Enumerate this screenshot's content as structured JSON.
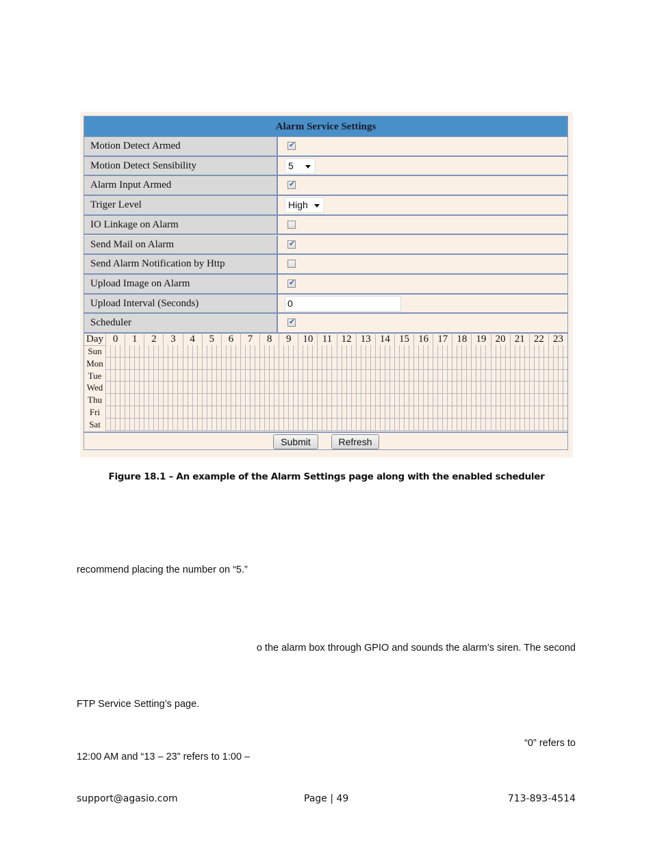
{
  "panel": {
    "title": "Alarm Service Settings",
    "rows": [
      {
        "label": "Motion Detect Armed",
        "type": "checkbox",
        "checked": true
      },
      {
        "label": "Motion Detect Sensibility",
        "type": "select",
        "value": "5"
      },
      {
        "label": "Alarm Input Armed",
        "type": "checkbox",
        "checked": true
      },
      {
        "label": "Triger Level",
        "type": "select",
        "value": "High"
      },
      {
        "label": "IO Linkage on Alarm",
        "type": "checkbox",
        "checked": false
      },
      {
        "label": "Send Mail on Alarm",
        "type": "checkbox",
        "checked": true
      },
      {
        "label": "Send Alarm Notification by Http",
        "type": "checkbox",
        "checked": false
      },
      {
        "label": "Upload Image on Alarm",
        "type": "checkbox",
        "checked": true
      },
      {
        "label": "Upload Interval (Seconds)",
        "type": "text",
        "value": "0"
      },
      {
        "label": "Scheduler",
        "type": "checkbox",
        "checked": true
      }
    ],
    "scheduler": {
      "day_header": "Day",
      "hours": [
        "0",
        "1",
        "2",
        "3",
        "4",
        "5",
        "6",
        "7",
        "8",
        "9",
        "10",
        "11",
        "12",
        "13",
        "14",
        "15",
        "16",
        "17",
        "18",
        "19",
        "20",
        "21",
        "22",
        "23"
      ],
      "days": [
        "Sun",
        "Mon",
        "Tue",
        "Wed",
        "Thu",
        "Fri",
        "Sat"
      ],
      "slots_per_hour": 4
    },
    "buttons": {
      "submit": "Submit",
      "refresh": "Refresh"
    }
  },
  "caption": "Figure 18.1 – An example of the Alarm Settings page along with the enabled scheduler",
  "paragraphs": {
    "p1": "recommend placing the number on “5.”",
    "p2": "o the alarm box through GPIO and sounds the alarm’s siren. The second",
    "p3": "FTP Service Setting’s page.",
    "p4a": "“0” refers to",
    "p4b": "12:00 AM and “13 – 23” refers to 1:00 –"
  },
  "footer": {
    "email": "support@agasio.com",
    "page": "Page | 49",
    "phone": "713-893-4514"
  }
}
